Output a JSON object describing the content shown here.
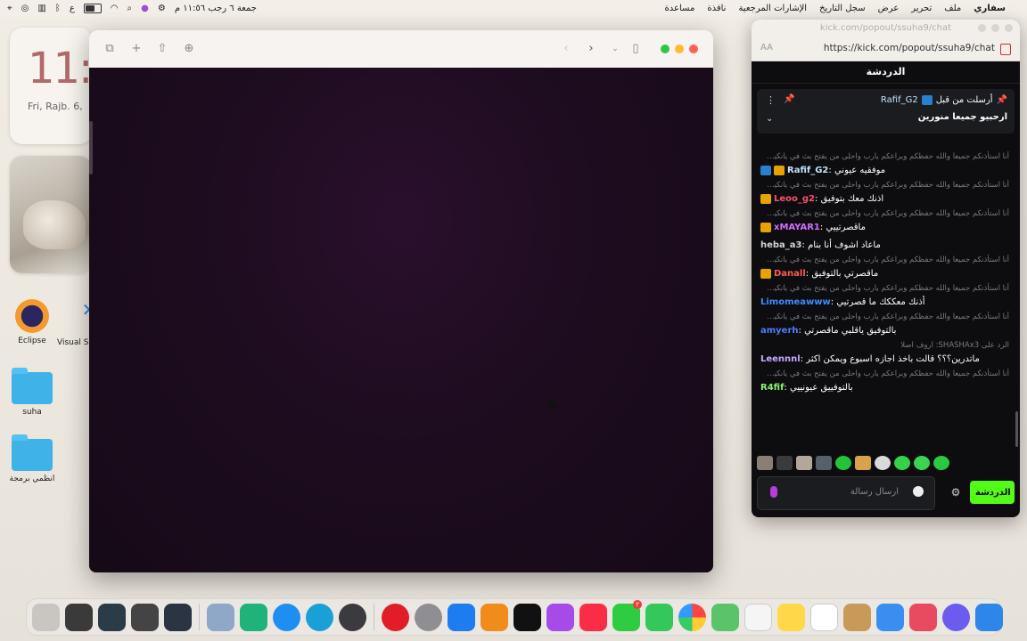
{
  "menubar": {
    "app_name": "سفاري",
    "menus": [
      "ملف",
      "تحرير",
      "عرض",
      "سجل التاريخ",
      "الإشارات المرجعية",
      "نافذة",
      "مساعدة"
    ],
    "datetime": "جمعة ٦ رجب  ١١:٥٦ م"
  },
  "desktop": {
    "clock_time": "11:",
    "clock_date": "Fri, Rajb. 6,",
    "icons": [
      {
        "label": "Eclipse",
        "icon": "eclipse-icon"
      },
      {
        "label": "Visual S",
        "icon": "vscode-icon"
      },
      {
        "label": "suha",
        "icon": "folder-icon"
      },
      {
        "label": "انظمي برمجة",
        "icon": "folder-icon"
      }
    ]
  },
  "chat_window": {
    "title": "kick.com/popout/ssuha9/chat",
    "url": "https://kick.com/popout/ssuha9/chat",
    "aa_label": "AA",
    "header": "الدردشة",
    "pinned": {
      "sent_by_label": "أرسلت من قبل",
      "user": "Rafif_G2",
      "message": "ارحبيو جميعا منورين"
    },
    "reply_prefix": "أنا استأذنكم جميعا والله حفظكم وبراعكم يارب واحلى من يفتح بث في يانكيك :...",
    "messages": [
      {
        "has_reply": true,
        "badges": [
          "blue",
          "gold"
        ],
        "user": "Rafif_G2",
        "user_color": "#c3e3ff",
        "text": "موفقيه عيوني"
      },
      {
        "has_reply": true,
        "badges": [
          "gold"
        ],
        "user": "Leoo_g2",
        "user_color": "#ff4f6d",
        "text": "اذنك معك بتوفيق"
      },
      {
        "has_reply": true,
        "badges": [
          "gold"
        ],
        "user": "xMAYAR1",
        "user_color": "#d56cff",
        "text": "ماقصرتييي"
      },
      {
        "has_reply": false,
        "badges": [],
        "user": "heba_a3",
        "user_color": "#cfd3d8",
        "text": "ماعاد اشوف أنا بنام"
      },
      {
        "has_reply": true,
        "badges": [
          "gold"
        ],
        "user": "Danall",
        "user_color": "#ff5a5a",
        "text": "ماقصرتي بالتوفيق"
      },
      {
        "has_reply": true,
        "badges": [],
        "user": "Limomeawww",
        "user_color": "#3d8cff",
        "text": "أذنك معككك ما قصرتيي"
      },
      {
        "has_reply": true,
        "badges": [],
        "user": "amyerh",
        "user_color": "#4c7dff",
        "text": "بالتوفيق ياقلبي ماقصرتي"
      },
      {
        "has_reply": true,
        "reply_text": "الرد على SHASHAx3: اروف اصلا",
        "badges": [],
        "user": "Leennnl",
        "user_color": "#c8a8ff",
        "text": "ماتدرين؟؟؟ قالت باخذ اجازه اسبوع ويمكن اكثر"
      },
      {
        "has_reply": true,
        "badges": [],
        "user": "R4fif",
        "user_color": "#89f56a",
        "text": "بالتوفييق عيونييي"
      }
    ],
    "composer_placeholder": "ارسال رسالة",
    "send_label": "الدردشة"
  },
  "colors": {
    "kick_green": "#53fc18",
    "safari_content": "#1d0c1f"
  }
}
